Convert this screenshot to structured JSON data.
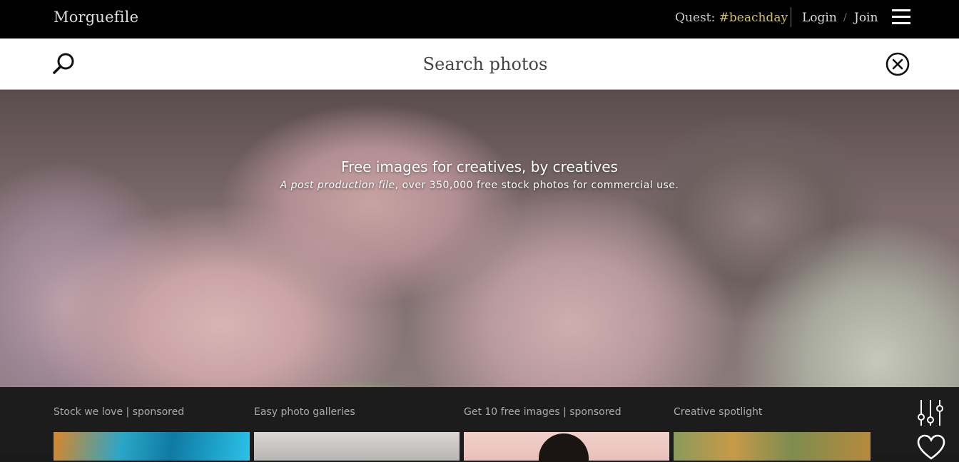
{
  "header": {
    "logo": "Morguefile",
    "quest_label": "Quest:",
    "quest_tag": "#beachday",
    "login": "Login",
    "separator": "/",
    "join": "Join"
  },
  "search": {
    "placeholder": "Search photos"
  },
  "hero": {
    "title": "Free images for creatives, by creatives",
    "subtitle_italic": "A post production file",
    "subtitle_rest": ", over 350,000 free stock photos for commercial use."
  },
  "sections": [
    {
      "label": "Stock we love | sponsored"
    },
    {
      "label": "Easy photo galleries"
    },
    {
      "label": "Get 10 free images | sponsored"
    },
    {
      "label": "Creative spotlight"
    }
  ],
  "icons": {
    "search": "search-icon",
    "clear": "close-circle-icon",
    "menu": "hamburger-menu-icon",
    "filters": "sliders-icon",
    "favorites": "heart-icon"
  },
  "colors": {
    "topbar": "#000000",
    "quest_tag": "#d6c15a",
    "bottom_bar": "#1c1c1c"
  }
}
